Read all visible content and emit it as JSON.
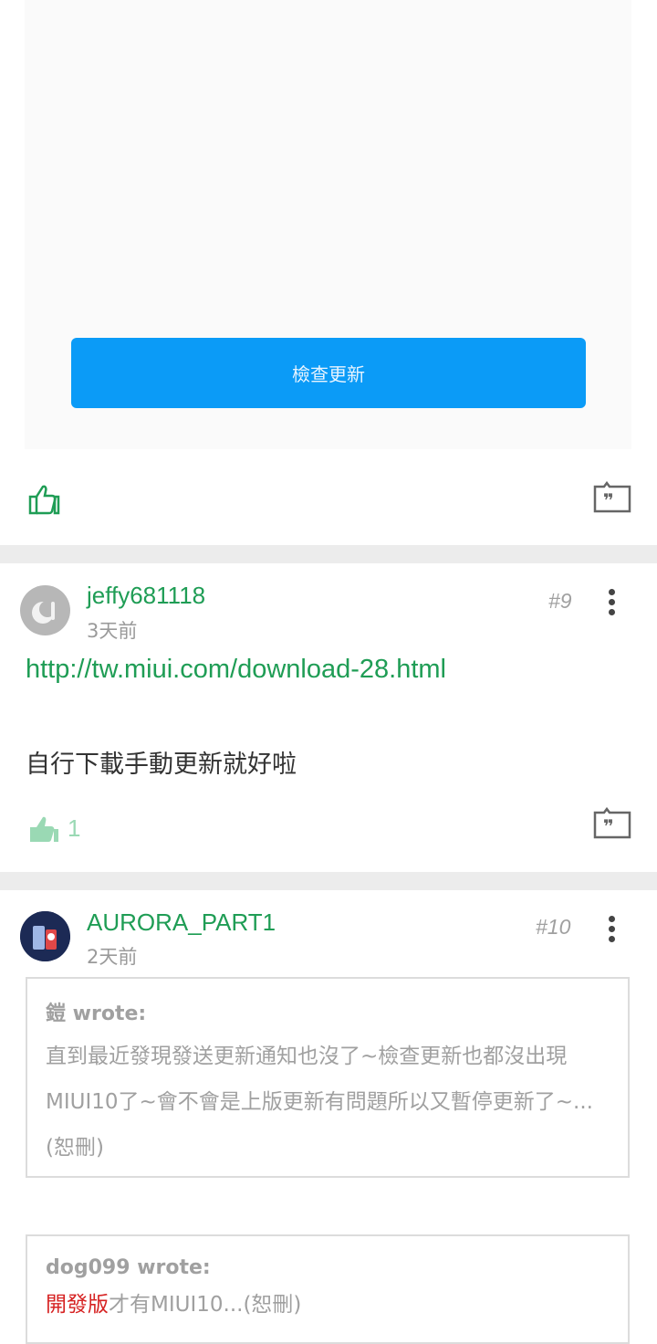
{
  "embedded_screenshot": {
    "check_update_label": "檢查更新"
  },
  "posts": [
    {
      "username": "jeffy681118",
      "time": "3天前",
      "floor": "#9",
      "link": "http://tw.miui.com/download-28.html",
      "text": "自行下載手動更新就好啦",
      "like_count": "1"
    },
    {
      "username": "AURORA_PART1",
      "time": "2天前",
      "floor": "#10",
      "quotes": [
        {
          "author": "鎧 wrote:",
          "body": "直到最近發現發送更新通知也沒了~檢查更新也都沒出現MIUI10了~會不會是上版更新有問題所以又暫停更新了~...(恕刪)"
        },
        {
          "author": "dog099 wrote:",
          "body_highlight": "開發版",
          "body_rest": "才有MIUI10...(恕刪)"
        }
      ]
    }
  ],
  "colors": {
    "accent_green": "#1f9d55",
    "button_blue": "#0b9bf7",
    "highlight_red": "#d62222"
  }
}
